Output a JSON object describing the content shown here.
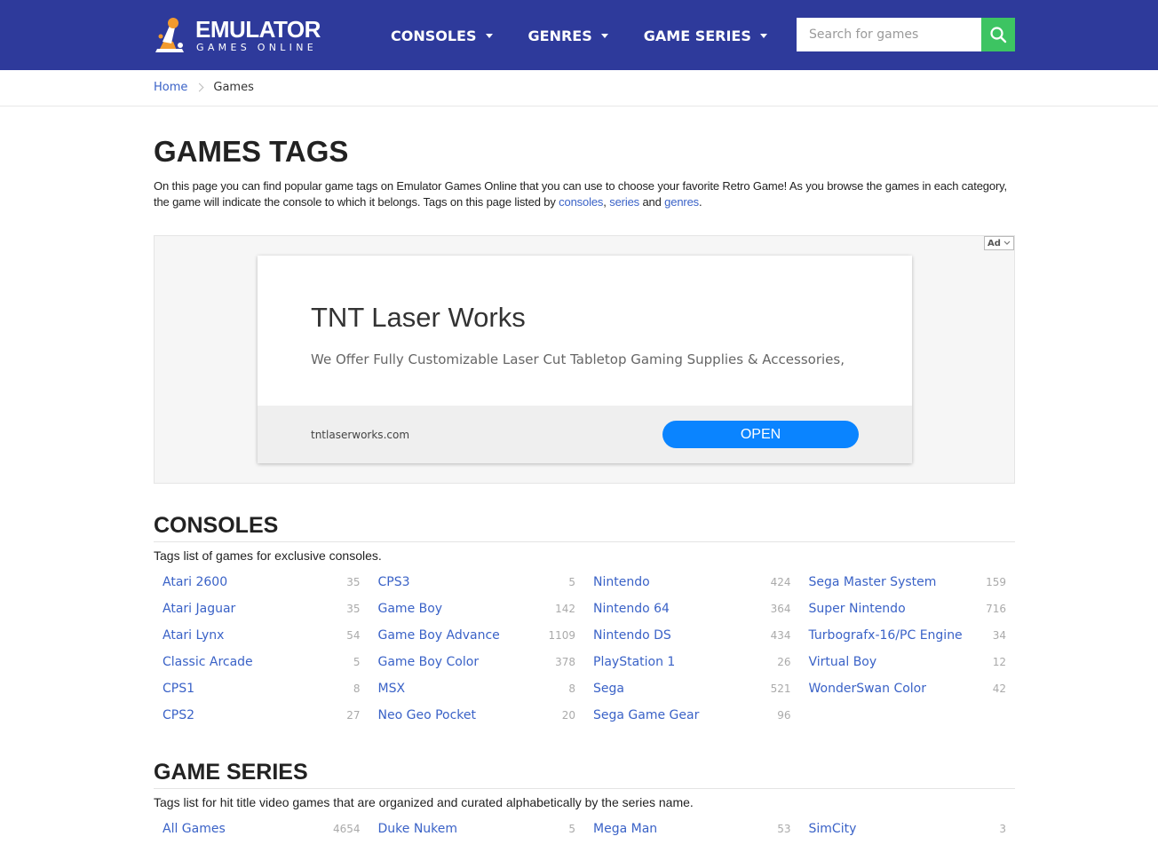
{
  "header": {
    "logo_title": "EMULATOR",
    "logo_subtitle": "GAMES ONLINE",
    "nav": [
      {
        "label": "CONSOLES"
      },
      {
        "label": "GENRES"
      },
      {
        "label": "GAME SERIES"
      }
    ],
    "search_placeholder": "Search for games",
    "colors": {
      "bar": "#2e3a9b",
      "search_button": "#3dc462"
    }
  },
  "breadcrumb": {
    "home": "Home",
    "current": "Games"
  },
  "page": {
    "title": "GAMES TAGS",
    "intro_text": "On this page you can find popular game tags on Emulator Games Online that you can use to choose your favorite Retro Game! As you browse the games in each category, the game will indicate the console to which it belongs. Tags on this page listed by ",
    "intro_link_consoles": "consoles",
    "intro_comma": ", ",
    "intro_link_series": "series",
    "intro_and": " and ",
    "intro_link_genres": "genres",
    "intro_end": "."
  },
  "ad": {
    "badge": "Ad",
    "title": "TNT Laser Works",
    "description": "We Offer Fully Customizable Laser Cut Tabletop Gaming Supplies & Accessories,",
    "domain": "tntlaserworks.com",
    "cta": "OPEN"
  },
  "consoles": {
    "title": "CONSOLES",
    "desc": "Tags list of games for exclusive consoles.",
    "columns": [
      [
        {
          "name": "Atari 2600",
          "count": "35"
        },
        {
          "name": "Atari Jaguar",
          "count": "35"
        },
        {
          "name": "Atari Lynx",
          "count": "54"
        },
        {
          "name": "Classic Arcade",
          "count": "5"
        },
        {
          "name": "CPS1",
          "count": "8"
        },
        {
          "name": "CPS2",
          "count": "27"
        }
      ],
      [
        {
          "name": "CPS3",
          "count": "5"
        },
        {
          "name": "Game Boy",
          "count": "142"
        },
        {
          "name": "Game Boy Advance",
          "count": "1109"
        },
        {
          "name": "Game Boy Color",
          "count": "378"
        },
        {
          "name": "MSX",
          "count": "8"
        },
        {
          "name": "Neo Geo Pocket",
          "count": "20"
        }
      ],
      [
        {
          "name": "Nintendo",
          "count": "424"
        },
        {
          "name": "Nintendo 64",
          "count": "364"
        },
        {
          "name": "Nintendo DS",
          "count": "434"
        },
        {
          "name": "PlayStation 1",
          "count": "26"
        },
        {
          "name": "Sega",
          "count": "521"
        },
        {
          "name": "Sega Game Gear",
          "count": "96"
        }
      ],
      [
        {
          "name": "Sega Master System",
          "count": "159"
        },
        {
          "name": "Super Nintendo",
          "count": "716"
        },
        {
          "name": "Turbografx-16/PC Engine",
          "count": "34"
        },
        {
          "name": "Virtual Boy",
          "count": "12"
        },
        {
          "name": "WonderSwan Color",
          "count": "42"
        }
      ]
    ]
  },
  "series": {
    "title": "GAME SERIES",
    "desc": "Tags list for hit title video games that are organized and curated alphabetically by the series name.",
    "columns": [
      [
        {
          "name": "All Games",
          "count": "4654"
        }
      ],
      [
        {
          "name": "Duke Nukem",
          "count": "5"
        }
      ],
      [
        {
          "name": "Mega Man",
          "count": "53"
        }
      ],
      [
        {
          "name": "SimCity",
          "count": "3"
        }
      ]
    ]
  }
}
